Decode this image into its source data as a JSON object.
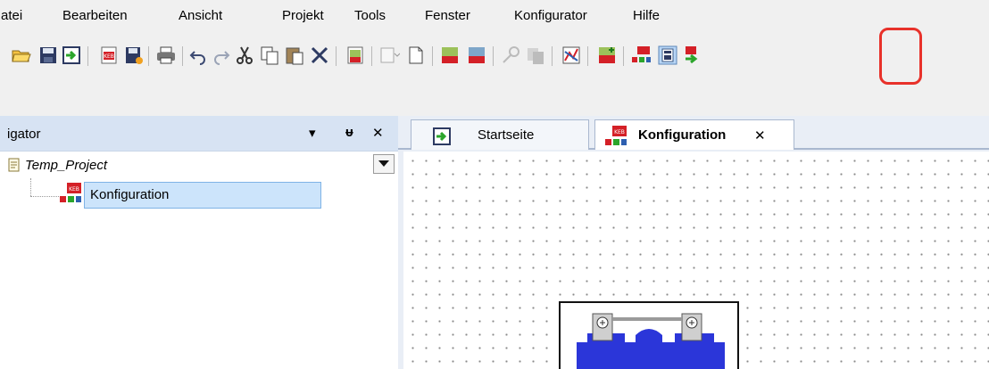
{
  "menu": {
    "items": [
      "atei",
      "Bearbeiten",
      "Ansicht",
      "Projekt",
      "Tools",
      "Fenster",
      "Konfigurator",
      "Hilfe"
    ]
  },
  "toolbar": {
    "icons": [
      "open-folder-icon",
      "save-icon",
      "import-icon",
      "keb-module-icon",
      "keb-save-icon",
      "print-icon",
      "undo-icon",
      "redo-icon",
      "cut-icon",
      "copy-icon",
      "paste-icon",
      "delete-icon",
      "keb-search-icon",
      "insert-icon",
      "new-document-icon",
      "keb-connect-icon",
      "keb-compare-icon",
      "key-icon",
      "copy-params-icon",
      "chart-icon",
      "keb-add-icon",
      "keb-network-icon",
      "configurator-panel-icon",
      "keb-export-icon"
    ],
    "highlighted_icon": "configurator-panel-icon",
    "highlight_color": "#e8312a"
  },
  "navigator": {
    "title": "igator",
    "dropdown_icon": "▾",
    "pin_icon": "ᵾ",
    "close_icon": "✕",
    "project_name": "Temp_Project",
    "tree_item": "Konfiguration",
    "selection_color": "#cce4fb"
  },
  "tabs": {
    "start": "Startseite",
    "config": "Konfiguration",
    "close_glyph": "✕"
  },
  "colors": {
    "device_blue": "#2b36d9",
    "panel_header": "#d7e3f3"
  }
}
